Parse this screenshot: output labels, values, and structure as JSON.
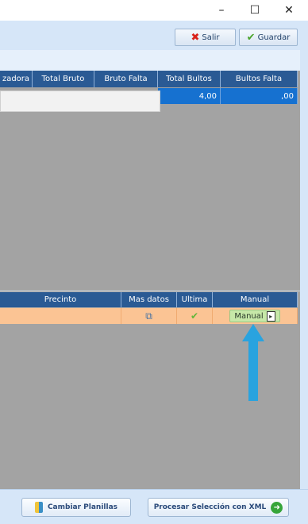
{
  "window": {
    "minimize_glyph": "–",
    "maximize_glyph": "☐",
    "close_glyph": "✕"
  },
  "toolbar": {
    "exit_label": "Salir",
    "save_label": "Guardar"
  },
  "top_table": {
    "headers": [
      "zadora",
      "Total Bruto",
      "Bruto Falta",
      "Total Bultos",
      "Bultos Falta"
    ],
    "row": {
      "total_bultos": "4,00",
      "bultos_falta": ",00"
    }
  },
  "bottom_table": {
    "headers": [
      "Precinto",
      "Mas datos",
      "Ultima",
      "Manual"
    ],
    "row": {
      "manual_label": "Manual"
    }
  },
  "actions": {
    "change_sheets_label": "Cambiar Planillas",
    "process_xml_label": "Procesar Selección con XML"
  },
  "colors": {
    "accent_blue": "#2a5a94",
    "selected_row": "#1671d0",
    "highlight_row": "#fbc494",
    "arrow": "#29a3df"
  }
}
